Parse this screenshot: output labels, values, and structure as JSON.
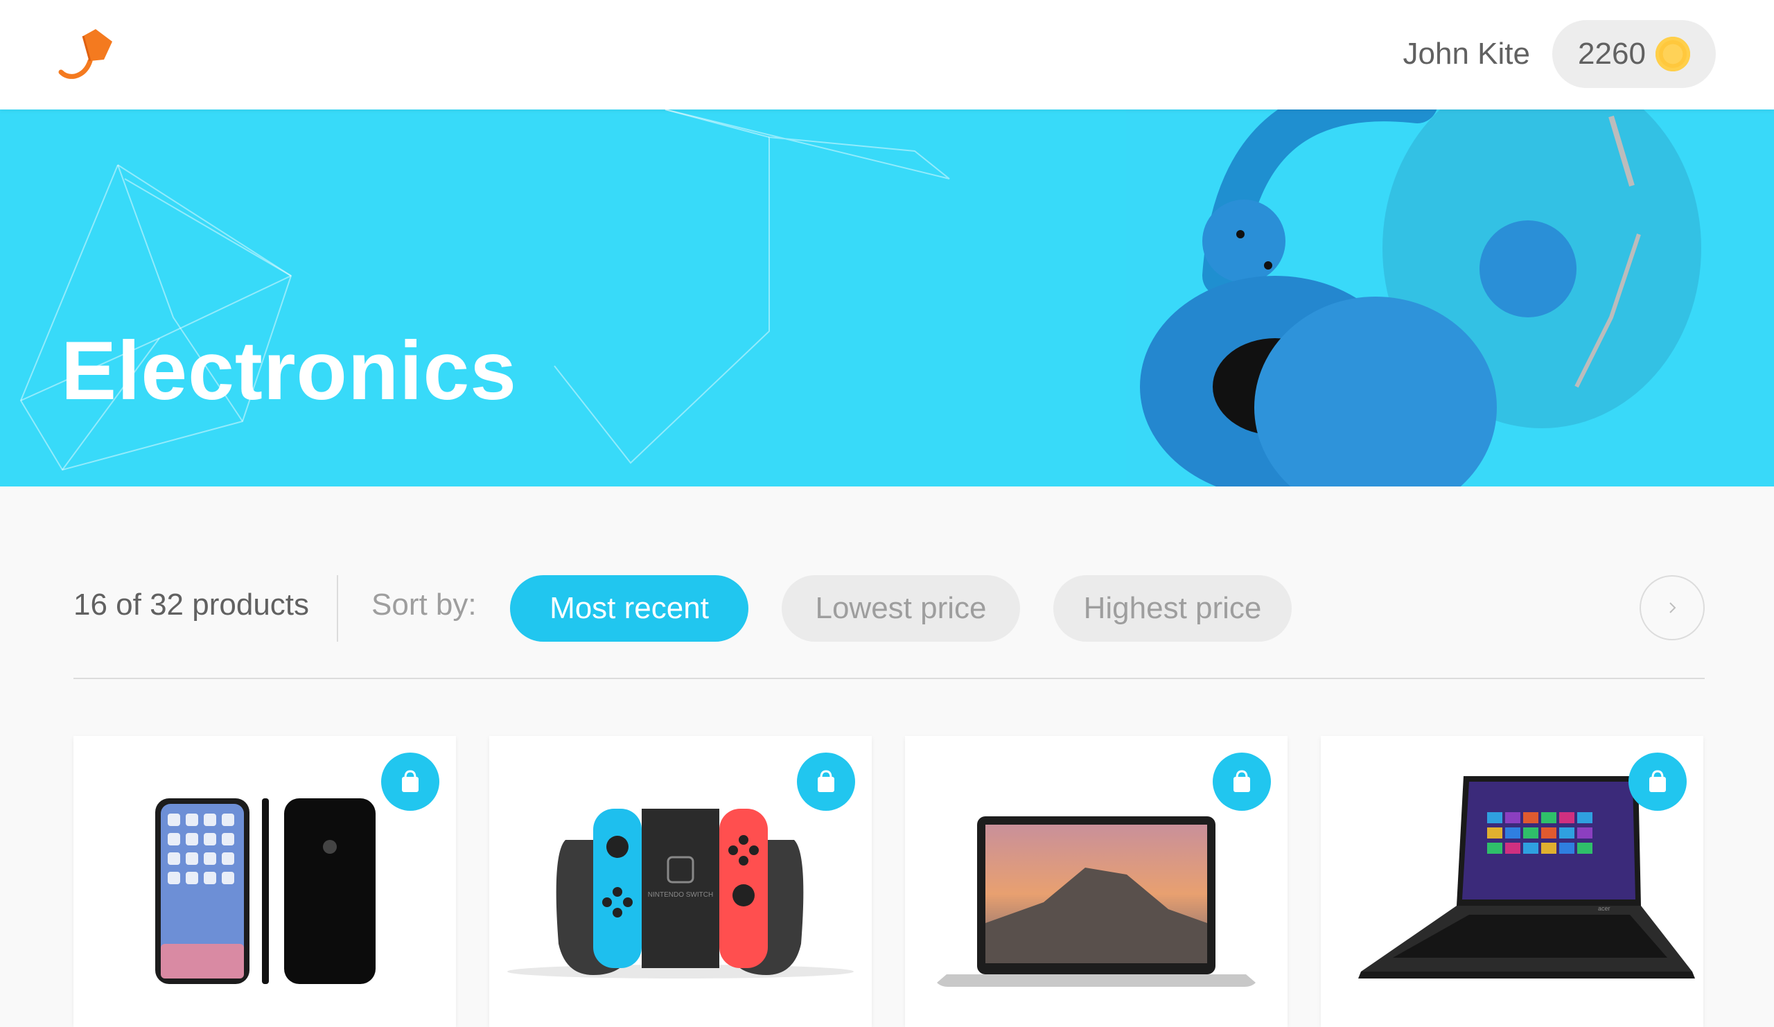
{
  "header": {
    "user_name": "John Kite",
    "points": "2260",
    "logo_icon": "dropp-bag-logo-icon",
    "coin_icon": "coin-icon"
  },
  "banner": {
    "title": "Electronics",
    "image": "blue-headphones-photo"
  },
  "toolbar": {
    "count_text": "16 of 32 products",
    "sort_label": "Sort by:",
    "sort_options": [
      {
        "label": "Most recent",
        "active": true
      },
      {
        "label": "Lowest price",
        "active": false
      },
      {
        "label": "Highest price",
        "active": false
      }
    ],
    "next_icon": "chevron-right-icon"
  },
  "products": [
    {
      "image": "iphone-x-photo",
      "action_icon": "shopping-bag-icon"
    },
    {
      "image": "nintendo-switch-controller-photo",
      "action_icon": "shopping-bag-icon"
    },
    {
      "image": "macbook-pro-photo",
      "action_icon": "shopping-bag-icon"
    },
    {
      "image": "acer-laptop-photo",
      "action_icon": "shopping-bag-icon"
    }
  ],
  "product_image_text": {
    "switch_brand": "NINTENDO SWITCH",
    "laptop_brand": "acer"
  },
  "colors": {
    "accent": "#21c6ef",
    "banner_bg": "#38daf9",
    "logo": "#f47a1f",
    "coin": "#ffc83d"
  }
}
